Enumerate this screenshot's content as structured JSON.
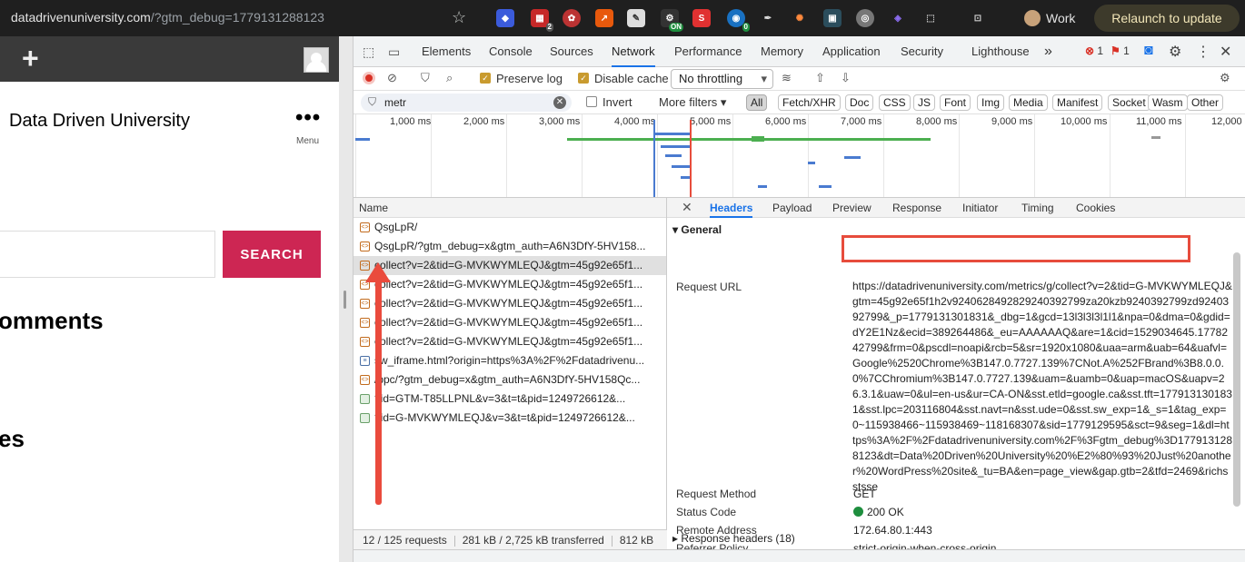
{
  "browser": {
    "url_host": "datadrivenuniversity.com",
    "url_path": "/?gtm_debug=1779131288123",
    "profile_label": "Work",
    "relaunch_label": "Relaunch to update",
    "ext_badge_1": "2",
    "ext_badge_2": "ON",
    "ext_badge_3": "0"
  },
  "site": {
    "title": "Data Driven University",
    "menu_label": "Menu",
    "search_button": "SEARCH",
    "heading_comments": "omments",
    "heading_es": "es"
  },
  "devtools": {
    "tabs": [
      "Elements",
      "Console",
      "Sources",
      "Network",
      "Performance",
      "Memory",
      "Application",
      "Security",
      "Lighthouse"
    ],
    "more": "»",
    "errors": "1",
    "issues": "1",
    "preserve_log": "Preserve log",
    "disable_cache": "Disable cache",
    "throttling": "No throttling",
    "filter_value": "metr",
    "invert": "Invert",
    "more_filters": "More filters ▾",
    "type_chips": [
      "All",
      "Fetch/XHR",
      "Doc",
      "CSS",
      "JS",
      "Font",
      "Img",
      "Media",
      "Manifest",
      "Socket",
      "Wasm",
      "Other"
    ],
    "timeline_labels": [
      "1,000 ms",
      "2,000 ms",
      "3,000 ms",
      "4,000 ms",
      "5,000 ms",
      "6,000 ms",
      "7,000 ms",
      "8,000 ms",
      "9,000 ms",
      "10,000 ms",
      "11,000 ms",
      "12,000"
    ]
  },
  "requests": {
    "header": "Name",
    "rows": [
      "QsgLpR/",
      "QsgLpR/?gtm_debug=x&gtm_auth=A6N3DfY-5HV158...",
      "collect?v=2&tid=G-MVKWYMLEQJ&gtm=45g92e65f1...",
      "collect?v=2&tid=G-MVKWYMLEQJ&gtm=45g92e65f1...",
      "collect?v=2&tid=G-MVKWYMLEQJ&gtm=45g92e65f1...",
      "collect?v=2&tid=G-MVKWYMLEQJ&gtm=45g92e65f1...",
      "collect?v=2&tid=G-MVKWYMLEQJ&gtm=45g92e65f1...",
      "sw_iframe.html?origin=https%3A%2F%2Fdatadrivenu...",
      "/ppc/?gtm_debug=x&gtm_auth=A6N3DfY-5HV158Qc...",
      "?id=GTM-T85LLPNL&v=3&t=t&pid=1249726612&...",
      "?id=G-MVKWYMLEQJ&v=3&t=t&pid=1249726612&..."
    ],
    "status_count": "12 / 125 requests",
    "status_transferred": "281 kB / 2,725 kB transferred",
    "status_resources": "812 kB"
  },
  "details": {
    "tabs": [
      "Headers",
      "Payload",
      "Preview",
      "Response",
      "Initiator",
      "Timing",
      "Cookies"
    ],
    "section_general": "▾ General",
    "request_url_label": "Request URL",
    "request_url": "https://datadrivenuniversity.com/metrics/g/collect?v=2&tid=G-MVKWYMLEQJ&gtm=45g92e65f1h2v9240628492829240392799za20kzb9240392799zd9240392799&_p=1779131301831&_dbg=1&gcd=13l3l3l3l1l1&npa=0&dma=0&gdid=dY2E1Nz&ecid=389264486&_eu=AAAAAAQ&are=1&cid=1529034645.1778242799&frm=0&pscdl=noapi&rcb=5&sr=1920x1080&uaa=arm&uab=64&uafvl=Google%2520Chrome%3B147.0.7727.139%7CNot.A%252FBrand%3B8.0.0.0%7CChromium%3B147.0.7727.139&uam=&uamb=0&uap=macOS&uapv=26.3.1&uaw=0&ul=en-us&ur=CA-ON&sst.etld=google.ca&sst.tft=1779131301831&sst.lpc=203116804&sst.navt=n&sst.ude=0&sst.sw_exp=1&_s=1&tag_exp=0~115938466~115938469~118168307&sid=1779129595&sct=9&seg=1&dl=https%3A%2F%2Fdatadrivenuniversity.com%2F%3Fgtm_debug%3D1779131288123&dt=Data%20Driven%20University%20%E2%80%93%20Just%20another%20WordPress%20site&_tu=BA&en=page_view&gap.gtb=2&tfd=2469&richsstsse",
    "request_method_label": "Request Method",
    "request_method": "GET",
    "status_code_label": "Status Code",
    "status_code": "200 OK",
    "remote_address_label": "Remote Address",
    "remote_address": "172.64.80.1:443",
    "referrer_policy_label": "Referrer Policy",
    "referrer_policy": "strict-origin-when-cross-origin",
    "response_headers": "▸ Response headers (18)"
  }
}
